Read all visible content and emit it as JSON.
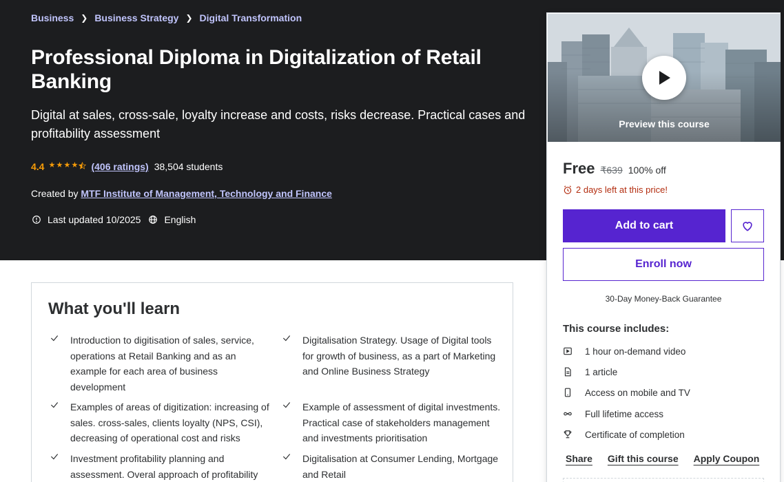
{
  "breadcrumb": [
    "Business",
    "Business Strategy",
    "Digital Transformation"
  ],
  "course": {
    "title": "Professional Diploma in Digitalization of Retail Banking",
    "subtitle": "Digital at sales, cross-sale, loyalty increase and costs, risks decrease. Practical cases and profitability assessment",
    "rating": "4.4",
    "rating_value": 4.4,
    "ratings_count": "(406 ratings)",
    "students": "38,504 students",
    "created_by_label": "Created by",
    "creator": "MTF Institute of Management, Technology and Finance",
    "last_updated": "Last updated 10/2025",
    "language": "English"
  },
  "learn": {
    "title": "What you'll learn",
    "items": [
      "Introduction to digitisation of sales, service, operations at Retail Banking and as an example for each area of business development",
      "Digitalisation Strategy. Usage of Digital tools for growth of business, as a part of Marketing and Online Business Strategy",
      "Examples of areas of digitization: increasing of sales. cross-sales, clients loyalty (NPS, CSI), decreasing of operational cost and risks",
      "Example of assessment of digital investments. Practical case of stakeholders management and investments prioritisation",
      "Investment profitability planning and assessment. Overal approach of profitability",
      "Digitalisation at Consumer Lending, Mortgage and Retail"
    ]
  },
  "sidebar": {
    "preview_label": "Preview this course",
    "price": "Free",
    "old_price": "₹639",
    "discount": "100% off",
    "deadline": "2 days left at this price!",
    "add_to_cart": "Add to cart",
    "enroll_now": "Enroll now",
    "guarantee": "30-Day Money-Back Guarantee",
    "includes_title": "This course includes:",
    "includes": [
      {
        "icon": "video-icon",
        "text": "1 hour on-demand video"
      },
      {
        "icon": "file-icon",
        "text": "1 article"
      },
      {
        "icon": "mobile-icon",
        "text": "Access on mobile and TV"
      },
      {
        "icon": "infinity-icon",
        "text": "Full lifetime access"
      },
      {
        "icon": "trophy-icon",
        "text": "Certificate of completion"
      }
    ],
    "share": "Share",
    "gift": "Gift this course",
    "coupon": "Apply Coupon"
  },
  "colors": {
    "hero_bg": "#1c1d1f",
    "accent": "#5624d0",
    "link": "#c0c4fc",
    "star": "#f69c08",
    "deadline": "#b32d0f"
  }
}
